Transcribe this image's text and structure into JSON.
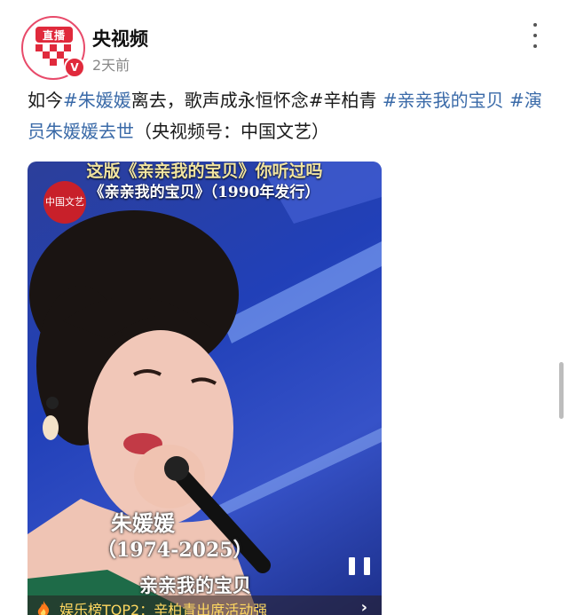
{
  "account": {
    "name": "央视频",
    "time": "2天前",
    "avatar_tag": "直播",
    "verified_badge": "V"
  },
  "post": {
    "segments": [
      {
        "text": "如今",
        "tag": false
      },
      {
        "text": "#朱媛媛",
        "tag": true
      },
      {
        "text": "离去，歌声成永恒怀念",
        "tag": false
      },
      {
        "text": "#辛柏青",
        "tag": false
      },
      {
        "text": " ",
        "tag": false
      },
      {
        "text": "#亲亲我的宝贝",
        "tag": true
      },
      {
        "text": " ",
        "tag": false
      },
      {
        "text": "#演员朱媛媛去世",
        "tag": true
      },
      {
        "text": "（央视频号：中国文艺）",
        "tag": false
      }
    ]
  },
  "video": {
    "title_top": "这版《亲亲我的宝贝》你听过吗",
    "title_sub": "《亲亲我的宝贝》（1990年发行）",
    "channel_logo": "中国文艺",
    "singer_name": "朱媛媛",
    "singer_years": "（1974-2025）",
    "song_caption": "亲亲我的宝贝",
    "hot_text": "娱乐榜TOP2：辛柏青出席活动强",
    "hot_chevron": "›"
  },
  "colors": {
    "accent_tag": "#3a6aa8",
    "brand_red": "#e02a3c",
    "hot_text": "#ffd860"
  },
  "icons": {
    "more": "more-vertical-icon",
    "pause": "pause-icon",
    "fire": "fire-icon"
  }
}
